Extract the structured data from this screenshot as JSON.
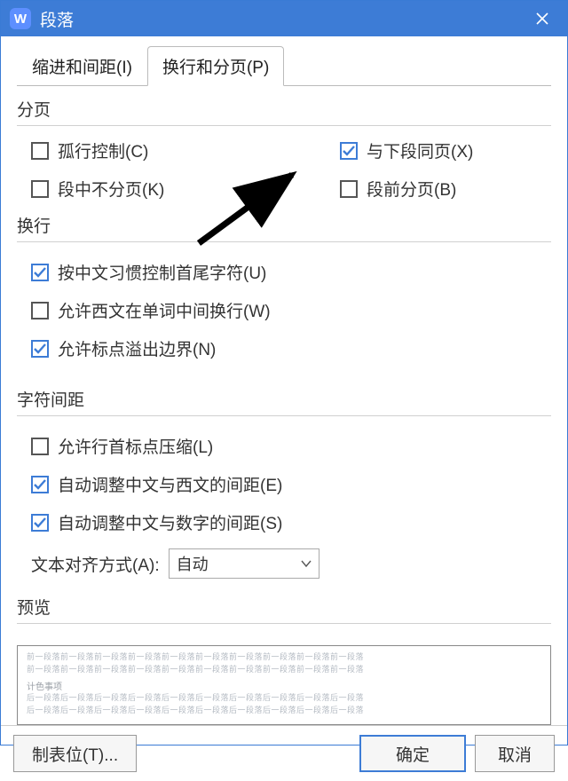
{
  "window": {
    "title": "段落"
  },
  "tabs": {
    "indent": "缩进和间距(I)",
    "break": "换行和分页(P)"
  },
  "sections": {
    "pagination": {
      "label": "分页",
      "widow": {
        "label": "孤行控制(C)",
        "checked": false
      },
      "keep_with_next": {
        "label": "与下段同页(X)",
        "checked": true
      },
      "keep_together": {
        "label": "段中不分页(K)",
        "checked": false
      },
      "page_break_before": {
        "label": "段前分页(B)",
        "checked": false
      }
    },
    "linebreak": {
      "label": "换行",
      "cjk_first_last": {
        "label": "按中文习惯控制首尾字符(U)",
        "checked": true
      },
      "allow_latin_break": {
        "label": "允许西文在单词中间换行(W)",
        "checked": false
      },
      "allow_punct_overflow": {
        "label": "允许标点溢出边界(N)",
        "checked": true
      }
    },
    "spacing": {
      "label": "字符间距",
      "punct_compress": {
        "label": "允许行首标点压缩(L)",
        "checked": false
      },
      "cjk_latin_space": {
        "label": "自动调整中文与西文的间距(E)",
        "checked": true
      },
      "cjk_digit_space": {
        "label": "自动调整中文与数字的间距(S)",
        "checked": true
      },
      "align_label": "文本对齐方式(A):",
      "align_value": "自动"
    },
    "preview": {
      "label": "预览",
      "mid": "计色事项",
      "filler_top": "前一段落前一段落前一段落前一段落前一段落前一段落前一段落前一段落前一段落前一段落",
      "filler_bot": "后一段落后一段落后一段落后一段落后一段落后一段落后一段落后一段落后一段落后一段落"
    }
  },
  "footer": {
    "tabs_btn": "制表位(T)...",
    "ok": "确定",
    "cancel": "取消"
  }
}
